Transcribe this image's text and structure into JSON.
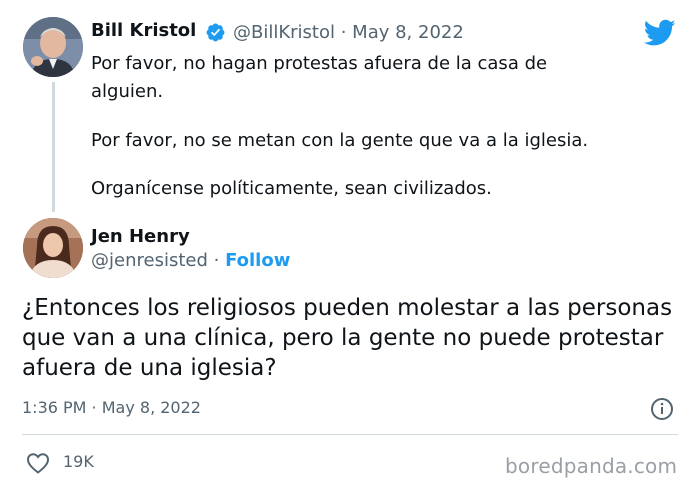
{
  "tweet": {
    "author_name": "Bill Kristol",
    "author_handle": "@BillKristol · May 8, 2022",
    "lines": [
      "Por favor, no hagan protestas afuera de la casa de",
      "alguien.",
      "Por favor, no se metan con la gente que va a la iglesia.",
      "Organícense políticamente, sean civilizados."
    ]
  },
  "reply": {
    "author_name": "Jen Henry",
    "author_handle": "@jenresisted ·",
    "follow_label": "Follow",
    "text": "¿Entonces los religiosos pueden molestar a las personas que van a una clínica, pero la gente no puede protestar afuera de una iglesia?",
    "timestamp": "1:36 PM · May 8, 2022",
    "like_count": "19K"
  },
  "watermark": "boredpanda.com",
  "colors": {
    "twitter_blue": "#1d9bf0",
    "secondary_text": "#536471"
  },
  "icons": [
    "twitter-bird-icon",
    "verified-badge-icon",
    "info-icon",
    "heart-icon"
  ]
}
